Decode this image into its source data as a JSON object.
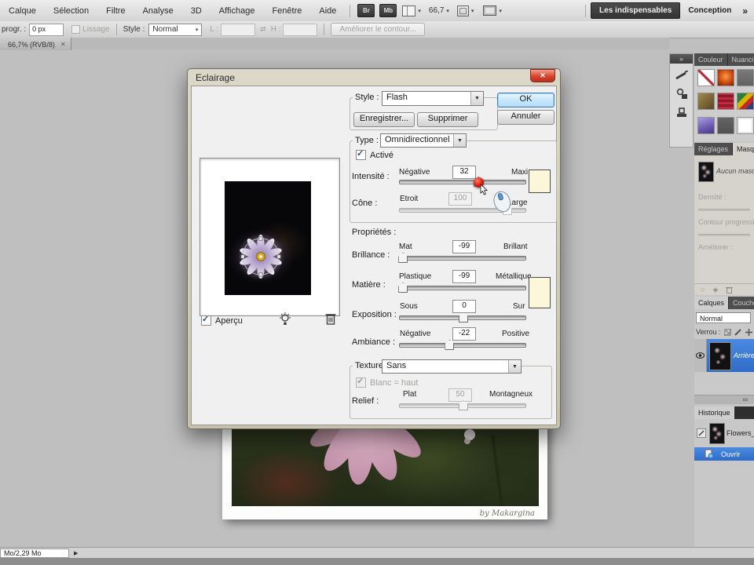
{
  "menu": {
    "items": [
      "Calque",
      "Sélection",
      "Filtre",
      "Analyse",
      "3D",
      "Affichage",
      "Fenêtre",
      "Aide"
    ],
    "bridge": "Br",
    "minibridge": "Mb",
    "zoom": "66,7",
    "caret": "▾",
    "workspace_active": "Les indispensables",
    "workspace_alt": "Conception",
    "more": "»"
  },
  "options": {
    "feather_label": "progr. :",
    "feather_value": "0 px",
    "antialias": "Lissage",
    "style_label": "Style :",
    "style_value": "Normal",
    "width_label": "L :",
    "link": "⇄",
    "height_label": "H :",
    "refine": "Améliorer le contour..."
  },
  "doc_tab": {
    "title": "66,7% (RVB/8)",
    "close": "✕"
  },
  "dialog": {
    "title": "Eclairage",
    "close": "✕",
    "ok": "OK",
    "cancel": "Annuler",
    "style": {
      "label": "Style :",
      "value": "Flash",
      "save": "Enregistrer...",
      "remove": "Supprimer"
    },
    "type": {
      "label": "Type :",
      "value": "Omnidirectionnel",
      "enabled": "Activé"
    },
    "intensity": {
      "label": "Intensité :",
      "min": "Négative",
      "value": "32",
      "max": "Maxi"
    },
    "cone": {
      "label": "Cône :",
      "min": "Etroit",
      "value": "100",
      "max": "Large"
    },
    "properties_label": "Propriétés :",
    "gloss": {
      "label": "Brillance :",
      "min": "Mat",
      "value": "-99",
      "max": "Brillant"
    },
    "material": {
      "label": "Matière :",
      "min": "Plastique",
      "value": "-99",
      "max": "Métallique"
    },
    "exposure": {
      "label": "Exposition :",
      "min": "Sous",
      "value": "0",
      "max": "Sur"
    },
    "ambience": {
      "label": "Ambiance :",
      "min": "Négative",
      "value": "-22",
      "max": "Positive"
    },
    "texture": {
      "label": "Texture :",
      "value": "Sans",
      "white_is_high": "Blanc = haut"
    },
    "relief": {
      "label": "Relief :",
      "min": "Plat",
      "value": "50",
      "max": "Montagneux"
    },
    "preview": "Aperçu"
  },
  "panels": {
    "dock_more": "»",
    "swatches": {
      "tab1": "Couleur",
      "tab2": "Nuancier"
    },
    "masks": {
      "tab1": "Réglages",
      "tab2": "Masques",
      "empty": "Aucun masque",
      "density": "Densité :",
      "feather": "Contour progressif :",
      "refine": "Améliorer :"
    },
    "layers": {
      "tab1": "Calques",
      "tab2": "Couches",
      "blend": "Normal",
      "lock": "Verrou :",
      "name": "Arrière-plan",
      "link": "∞"
    },
    "history": {
      "tab": "Historique",
      "snapshot": "Flowers_b",
      "state": "Ouvrir"
    }
  },
  "status": {
    "size": "Mo/2,29 Mo",
    "arrow": "▶"
  },
  "photo": {
    "credit": "by Makargina"
  }
}
